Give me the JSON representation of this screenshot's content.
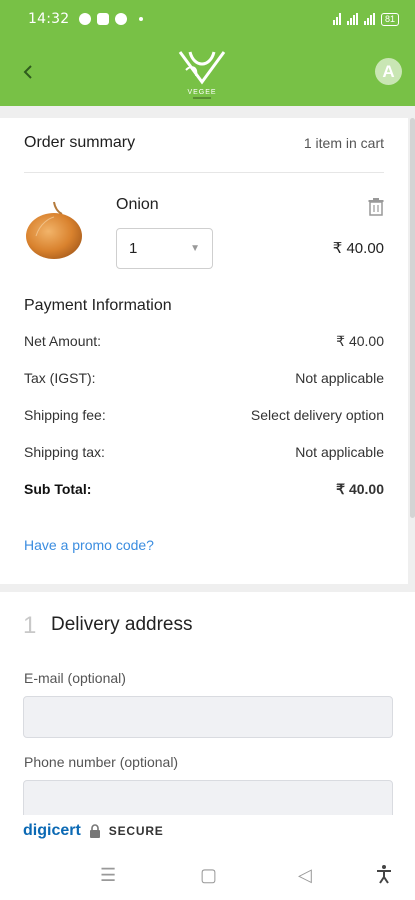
{
  "status": {
    "time": "14:32",
    "battery": "81"
  },
  "header": {
    "logo_text": "VEGEE",
    "avatar_initial": "A"
  },
  "order_summary": {
    "title": "Order summary",
    "items_count": "1 item in cart",
    "product": {
      "name": "Onion",
      "quantity": "1",
      "price": "₹ 40.00"
    }
  },
  "payment": {
    "title": "Payment Information",
    "rows": [
      {
        "label": "Net Amount:",
        "value": "₹ 40.00"
      },
      {
        "label": "Tax (IGST):",
        "value": "Not applicable"
      },
      {
        "label": "Shipping fee:",
        "value": "Select delivery option"
      },
      {
        "label": "Shipping tax:",
        "value": "Not applicable"
      },
      {
        "label": "Sub Total:",
        "value": "₹ 40.00"
      }
    ],
    "promo_link": "Have a promo code?"
  },
  "delivery": {
    "step": "1",
    "title": "Delivery address",
    "email_label": "E-mail (optional)",
    "phone_label": "Phone number (optional)"
  },
  "secure": {
    "brand": "digicert",
    "label": "SECURE"
  },
  "colors": {
    "brand_green": "#78c146",
    "link_blue": "#3b8de0"
  }
}
